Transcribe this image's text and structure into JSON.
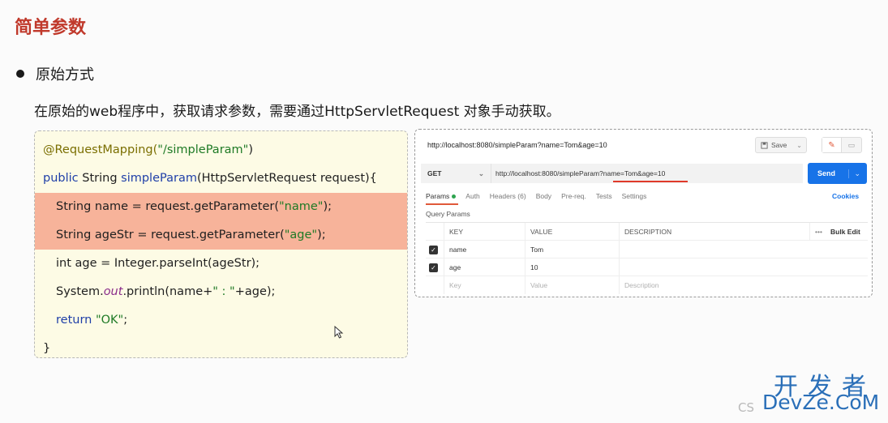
{
  "slide": {
    "title": "简单参数",
    "bullet": "原始方式",
    "description": "在原始的web程序中，获取请求参数，需要通过HttpServletRequest 对象手动获取。"
  },
  "code": {
    "line1": {
      "ann": "@RequestMapping(",
      "str": "\"/simpleParam\"",
      "tail": ")"
    },
    "line2": {
      "kw": "public",
      "type": " String ",
      "fn": "simpleParam",
      "tail": "(HttpServletRequest request){"
    },
    "line3": {
      "head": "String name = request.getParameter(",
      "str": "\"name\"",
      "tail": ");"
    },
    "line4": {
      "head": "String ageStr = request.getParameter(",
      "str": "\"age\"",
      "tail": ");"
    },
    "line5": {
      "head": "int age = Integer.parseInt(ageStr);"
    },
    "line6": {
      "head": "System.",
      "it": "out",
      "mid": ".println(name+",
      "str": "\"  :  \"",
      "tail": "+age);"
    },
    "line7": {
      "kw": "return",
      "str": " \"OK\"",
      "tail": ";"
    },
    "line8": {
      "head": "}"
    }
  },
  "postman": {
    "top_url": "http://localhost:8080/simpleParam?name=Tom&age=10",
    "save_label": "Save",
    "method": "GET",
    "request_url": "http://localhost:8080/simpleParam?name=Tom&age=10",
    "send_label": "Send",
    "tabs": [
      "Params",
      "Auth",
      "Headers (6)",
      "Body",
      "Pre-req.",
      "Tests",
      "Settings"
    ],
    "cookies_label": "Cookies",
    "query_params_label": "Query Params",
    "table": {
      "headers": {
        "key": "KEY",
        "value": "VALUE",
        "description": "DESCRIPTION",
        "more": "•••",
        "bulk_edit": "Bulk Edit"
      },
      "rows": [
        {
          "key": "name",
          "value": "Tom",
          "checked": true
        },
        {
          "key": "age",
          "value": "10",
          "checked": true
        }
      ],
      "placeholder": {
        "key": "Key",
        "value": "Value",
        "description": "Description"
      }
    }
  },
  "watermark": {
    "cn": "开发者",
    "cs": "CS",
    "en": "DevZe.CoM"
  }
}
